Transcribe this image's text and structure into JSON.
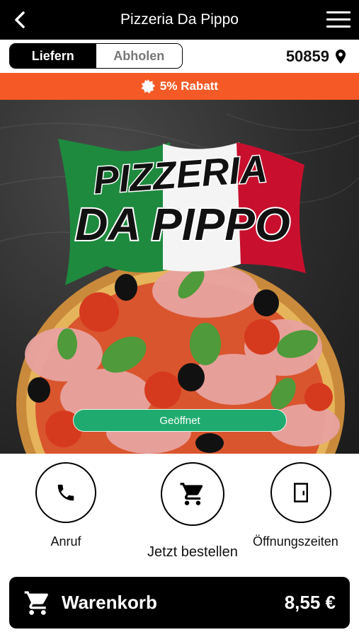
{
  "header": {
    "title": "Pizzeria Da Pippo",
    "back_icon": "chevron-left-icon",
    "menu_icon": "hamburger-menu-icon"
  },
  "mode_toggle": {
    "options": [
      {
        "label": "Liefern",
        "active": true
      },
      {
        "label": "Abholen",
        "active": false
      }
    ]
  },
  "location": {
    "zip": "50859",
    "icon": "map-pin-icon"
  },
  "promo": {
    "text": "5% Rabatt",
    "icon": "badge-icon",
    "color": "#f55a26"
  },
  "hero": {
    "logo_line1": "PIZZERIA",
    "logo_line2": "DA PIPPO",
    "flag_colors": [
      "#1e8a3e",
      "#ffffff",
      "#c8102e"
    ],
    "status_badge": {
      "text": "Geöffnet",
      "color": "#1fab6f"
    }
  },
  "actions": [
    {
      "label": "Anruf",
      "icon": "phone-icon"
    },
    {
      "label": "Jetzt bestellen",
      "icon": "shopping-cart-icon"
    },
    {
      "label": "Öffnungszeiten",
      "icon": "door-icon"
    }
  ],
  "cart": {
    "label": "Warenkorb",
    "total": "8,55 €",
    "icon": "shopping-cart-icon"
  }
}
